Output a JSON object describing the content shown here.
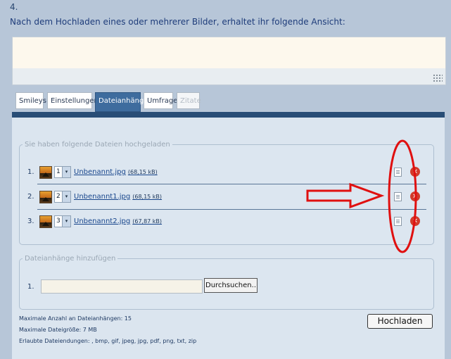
{
  "step": "4.",
  "intro": "Nach dem Hochladen eines oder mehrerer Bilder, erhaltet ihr folgende Ansicht:",
  "tabs": [
    {
      "label": "Smileys",
      "state": "normal"
    },
    {
      "label": "Einstellungen",
      "state": "normal"
    },
    {
      "label": "Dateianhänge",
      "state": "active"
    },
    {
      "label": "Umfrage",
      "state": "normal"
    },
    {
      "label": "Zitate",
      "state": "disabled"
    }
  ],
  "uploaded": {
    "legend": "Sie haben folgende Dateien hochgeladen",
    "files": [
      {
        "num": "1.",
        "order": "1",
        "name": "Unbenannt.jpg",
        "size": "(68,15 kB)"
      },
      {
        "num": "2.",
        "order": "2",
        "name": "Unbenannt1.jpg",
        "size": "(68,15 kB)"
      },
      {
        "num": "3.",
        "order": "3",
        "name": "Unbenannt2.jpg",
        "size": "(67,87 kB)"
      }
    ]
  },
  "add": {
    "legend": "Dateianhänge hinzufügen",
    "num": "1.",
    "browse_label": "Durchsuchen..",
    "file_value": ""
  },
  "info": {
    "max_count": "Maximale Anzahl an Dateianhängen: 15",
    "max_size": "Maximale Dateigröße: 7 MB",
    "extensions": "Erlaubte Dateiendungen: , bmp, gif, jpeg, jpg, pdf, png, txt, zip"
  },
  "upload_label": "Hochladen",
  "colors": {
    "page_bg": "#b7c6d8",
    "panel_header": "#284d76",
    "active_tab": "#3e6c9e",
    "annotation_red": "#e01010",
    "delete_icon": "#d23a2a"
  },
  "icons": {
    "sort_arrow": "▾",
    "delete": "×"
  }
}
